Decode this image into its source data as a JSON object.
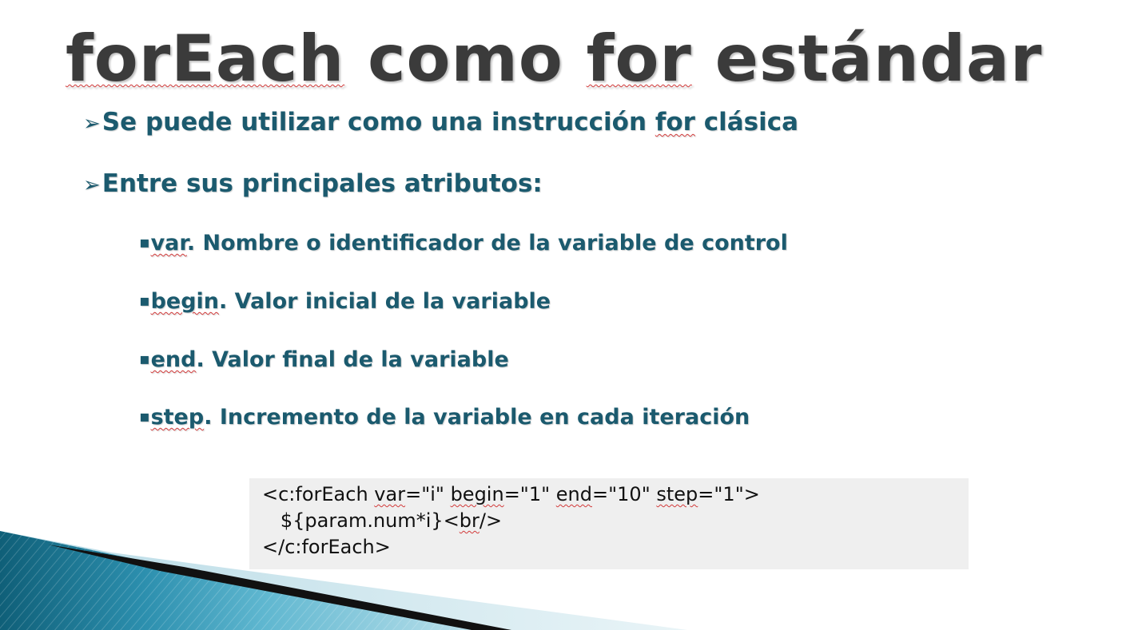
{
  "slide": {
    "title_part1": "forEach",
    "title_part2": " como ",
    "title_part3": "for",
    "title_part4": " estándar",
    "bullets": [
      {
        "pre": "Se puede utilizar como una instrucción ",
        "term": "for",
        "post": " clásica"
      },
      {
        "text": "Entre sus principales atributos:"
      }
    ],
    "attributes": [
      {
        "name": "var",
        "description": ". Nombre o identificador de la variable de control"
      },
      {
        "name": "begin",
        "description": ". Valor inicial de la variable"
      },
      {
        "name": "end",
        "description": ". Valor final de la variable"
      },
      {
        "name": "step",
        "description": ". Incremento de la variable en cada iteración"
      }
    ],
    "code": {
      "line1_a": "<c:forEach ",
      "line1_var": "var",
      "line1_b": "=\"i\" ",
      "line1_begin": "begin",
      "line1_c": "=\"1\" ",
      "line1_end": "end",
      "line1_d": "=\"10\" ",
      "line1_step": "step",
      "line1_e": "=\"1\">",
      "line2_a": "   ${param.num*i}<",
      "line2_br": "br",
      "line2_b": "/>",
      "line3": "</c:forEach>"
    }
  },
  "colors": {
    "title": "#3b3b3b",
    "body_text": "#1b5a6e",
    "code_bg": "#efefef",
    "spellcheck": "#d23a3a"
  },
  "icons": {
    "level1_bullet": "arrowhead-bullet",
    "level2_bullet": "square-bullet"
  }
}
